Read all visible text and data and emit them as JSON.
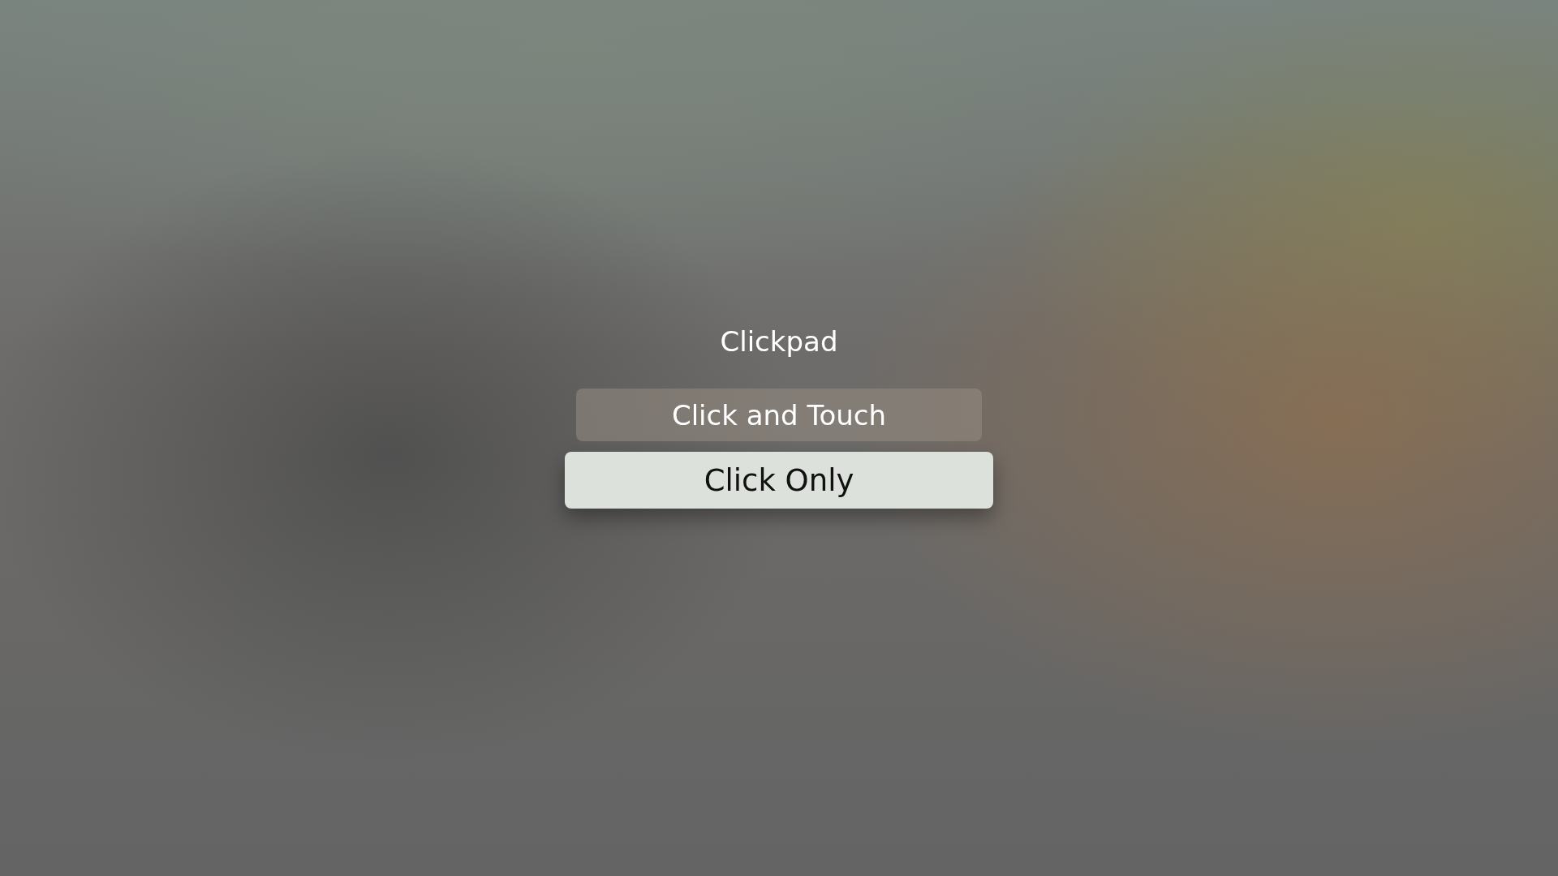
{
  "title": "Clickpad",
  "options": [
    {
      "label": "Click and Touch",
      "selected": false
    },
    {
      "label": "Click Only",
      "selected": true
    }
  ]
}
